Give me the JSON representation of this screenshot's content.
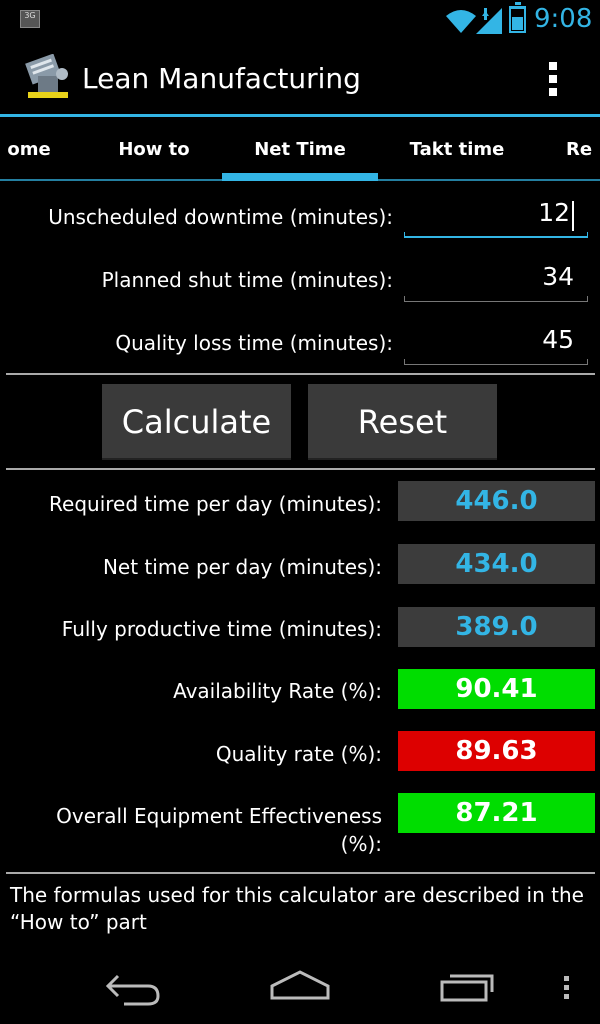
{
  "status_bar": {
    "network_badge": "3G",
    "time": "9:08",
    "battery_level": 0.6,
    "icons": [
      "wifi-icon",
      "signal-icon",
      "battery-icon"
    ]
  },
  "action_bar": {
    "title": "Lean Manufacturing",
    "icons": [
      "app-logo-icon",
      "overflow-menu-icon"
    ]
  },
  "tabs": [
    {
      "label": "Home",
      "visible_text": "ome"
    },
    {
      "label": "How to",
      "visible_text": "How to"
    },
    {
      "label": "Net Time",
      "visible_text": "Net Time",
      "selected": true
    },
    {
      "label": "Takt time",
      "visible_text": "Takt time"
    },
    {
      "label": "Re",
      "visible_text": "Re"
    }
  ],
  "inputs": [
    {
      "label": "Unscheduled downtime (minutes):",
      "value": "12",
      "focused": true
    },
    {
      "label": "Planned shut time (minutes):",
      "value": "34",
      "focused": false
    },
    {
      "label": "Quality loss time (minutes):",
      "value": "45",
      "focused": false
    }
  ],
  "buttons": {
    "calculate": "Calculate",
    "reset": "Reset"
  },
  "results": [
    {
      "label": "Required time per day (minutes):",
      "value": "446.0",
      "status": "neutral"
    },
    {
      "label": "Net time per day (minutes):",
      "value": "434.0",
      "status": "neutral"
    },
    {
      "label": "Fully productive time (minutes):",
      "value": "389.0",
      "status": "neutral"
    },
    {
      "label": "Availability Rate (%):",
      "value": "90.41",
      "status": "good"
    },
    {
      "label": "Quality rate (%):",
      "value": "89.63",
      "status": "bad"
    },
    {
      "label": "Overall Equipment Effectiveness (%):",
      "value": "87.21",
      "status": "good"
    }
  ],
  "footer_note": "The formulas used for this calculator are described in the “How to” part",
  "colors": {
    "accent": "#33b5e5",
    "good": "#00dd00",
    "bad": "#dd0000",
    "neutral_box": "#3c3c3c",
    "button": "#3a3a3a"
  },
  "nav_bar": {
    "icons": [
      "back-icon",
      "home-icon",
      "recent-apps-icon",
      "menu-icon"
    ]
  }
}
